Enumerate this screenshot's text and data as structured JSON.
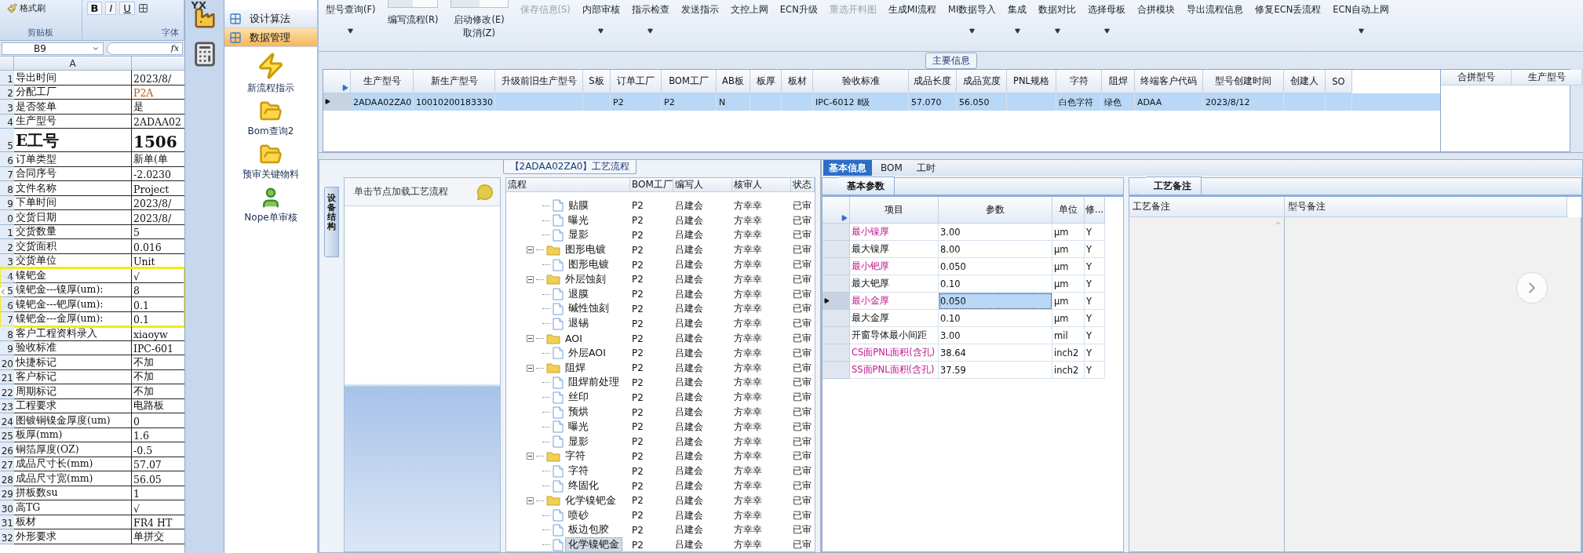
{
  "excel": {
    "ribbon": {
      "clipboard_button": "格式刷",
      "font_buttons": [
        "B",
        "I",
        "U"
      ],
      "groups": [
        "剪贴板",
        "字体"
      ]
    },
    "name_box": "B9",
    "formula_label": "fx",
    "column_headers": [
      "A"
    ],
    "rows": [
      {
        "number": "1",
        "label": "导出时间",
        "value": "2023/8/",
        "kind": "normal",
        "highlighted": false
      },
      {
        "number": "2",
        "label": "分配工厂",
        "value": "P2A",
        "kind": "accent",
        "highlighted": false
      },
      {
        "number": "3",
        "label": "是否签单",
        "value": "是",
        "kind": "normal",
        "highlighted": false
      },
      {
        "number": "4",
        "label": "生产型号",
        "value": "2ADAA02",
        "kind": "normal",
        "highlighted": false
      },
      {
        "number": "5",
        "label": "E工号",
        "value": "1506",
        "kind": "large",
        "highlighted": false
      },
      {
        "number": "6",
        "label": "订单类型",
        "value": "新单(单",
        "kind": "normal",
        "highlighted": false
      },
      {
        "number": "7",
        "label": "合同序号",
        "value": "-2.0230",
        "kind": "normal",
        "highlighted": false
      },
      {
        "number": "8",
        "label": "文件名称",
        "value": "Project",
        "kind": "normal",
        "highlighted": false
      },
      {
        "number": "9",
        "label": "下单时间",
        "value": "2023/8/",
        "kind": "normal",
        "highlighted": false
      },
      {
        "number": "0",
        "label": "交货日期",
        "value": "2023/8/",
        "kind": "normal",
        "highlighted": false
      },
      {
        "number": "1",
        "label": "交货数量",
        "value": "5",
        "kind": "normal",
        "highlighted": false
      },
      {
        "number": "2",
        "label": "交货面积",
        "value": "0.016",
        "kind": "normal",
        "highlighted": false
      },
      {
        "number": "3",
        "label": "交货单位",
        "value": "Unit",
        "kind": "normal",
        "highlighted": false
      },
      {
        "number": "4",
        "label": "镍钯金",
        "value": "√",
        "kind": "normal",
        "highlighted": true
      },
      {
        "number": "5",
        "label": "镍钯金---镍厚(um):",
        "value": "8",
        "kind": "normal",
        "highlighted": true
      },
      {
        "number": "6",
        "label": "镍钯金---钯厚(um):",
        "value": "0.1",
        "kind": "normal",
        "highlighted": true
      },
      {
        "number": "7",
        "label": "镍钯金---金厚(um):",
        "value": "0.1",
        "kind": "normal",
        "highlighted": true
      },
      {
        "number": "8",
        "label": "客户工程资料录入",
        "value": "xiaoyw",
        "kind": "normal",
        "highlighted": false
      },
      {
        "number": "9",
        "label": "验收标准",
        "value": "IPC-601",
        "kind": "normal",
        "highlighted": false
      },
      {
        "number": "20",
        "label": "快捷标记",
        "value": "不加",
        "kind": "normal",
        "highlighted": false
      },
      {
        "number": "21",
        "label": "客户标记",
        "value": "不加",
        "kind": "normal",
        "highlighted": false
      },
      {
        "number": "22",
        "label": "周期标记",
        "value": "不加",
        "kind": "normal",
        "highlighted": false
      },
      {
        "number": "23",
        "label": "工程要求",
        "value": "电路板",
        "kind": "normal",
        "highlighted": false
      },
      {
        "number": "24",
        "label": "图镀铜镍金厚度(um)",
        "value": "0",
        "kind": "normal",
        "highlighted": false
      },
      {
        "number": "25",
        "label": "板厚(mm)",
        "value": "1.6",
        "kind": "normal",
        "highlighted": false
      },
      {
        "number": "26",
        "label": "铜箔厚度(OZ)",
        "value": "-0.5",
        "kind": "normal",
        "highlighted": false
      },
      {
        "number": "27",
        "label": "成品尺寸长(mm)",
        "value": "57.07",
        "kind": "normal",
        "highlighted": false
      },
      {
        "number": "28",
        "label": "成品尺寸宽(mm)",
        "value": "56.05",
        "kind": "normal",
        "highlighted": false
      },
      {
        "number": "29",
        "label": "拼板数su",
        "value": "1",
        "kind": "normal",
        "highlighted": false
      },
      {
        "number": "30",
        "label": "高TG",
        "value": "√",
        "kind": "normal",
        "highlighted": false
      },
      {
        "number": "31",
        "label": "板材",
        "value": "FR4 HT",
        "kind": "normal",
        "highlighted": false
      },
      {
        "number": "32",
        "label": "外形要求",
        "value": "单拼交",
        "kind": "normal",
        "highlighted": false
      }
    ]
  },
  "app_strip": {
    "logo_text": "YX"
  },
  "nav": {
    "sections": [
      {
        "label": "设计算法",
        "selected": false
      },
      {
        "label": "数据管理",
        "selected": true
      }
    ],
    "tools": [
      {
        "label": "新流程指示",
        "kind": "bolt"
      },
      {
        "label": "Bom查询2",
        "kind": "folder"
      },
      {
        "label": "预审关键物料",
        "kind": "folder"
      },
      {
        "label": "Nope单审核",
        "kind": "person"
      }
    ]
  },
  "toolbar": [
    {
      "label": "型号查询(F)",
      "kind": "plain",
      "dropdown": true,
      "disabled": false
    },
    {
      "label": "编写流程(R)",
      "kind": "toggle",
      "dropdown": false,
      "disabled": false
    },
    {
      "label": "启动修改(E)",
      "sublabel": "取消(Z)",
      "kind": "toggle",
      "dropdown": false,
      "disabled": false
    },
    {
      "label": "保存信息(S)",
      "kind": "plain",
      "dropdown": false,
      "disabled": true
    },
    {
      "label": "内部审核",
      "kind": "plain",
      "dropdown": true,
      "disabled": false
    },
    {
      "label": "指示检查",
      "kind": "plain",
      "dropdown": true,
      "disabled": false
    },
    {
      "label": "发送指示",
      "kind": "plain",
      "dropdown": false,
      "disabled": false
    },
    {
      "label": "文控上网",
      "kind": "plain",
      "dropdown": false,
      "disabled": false
    },
    {
      "label": "ECN升级",
      "kind": "plain",
      "dropdown": false,
      "disabled": false
    },
    {
      "label": "重选开料图",
      "kind": "plain",
      "dropdown": false,
      "disabled": true
    },
    {
      "label": "生成MI流程",
      "kind": "plain",
      "dropdown": false,
      "disabled": false
    },
    {
      "label": "MI数据导入",
      "kind": "plain",
      "dropdown": true,
      "disabled": false
    },
    {
      "label": "集成",
      "kind": "plain",
      "dropdown": true,
      "disabled": false
    },
    {
      "label": "数据对比",
      "kind": "plain",
      "dropdown": true,
      "disabled": false
    },
    {
      "label": "选择母板",
      "kind": "plain",
      "dropdown": true,
      "disabled": false
    },
    {
      "label": "合拼模块",
      "kind": "plain",
      "dropdown": false,
      "disabled": false
    },
    {
      "label": "导出流程信息",
      "kind": "plain",
      "dropdown": false,
      "disabled": false
    },
    {
      "label": "修复ECN丢流程",
      "kind": "plain",
      "dropdown": false,
      "disabled": false
    },
    {
      "label": "ECN自动上网",
      "kind": "plain",
      "dropdown": true,
      "disabled": false
    }
  ],
  "main_info": {
    "title": "主要信息",
    "columns": [
      "生产型号",
      "新生产型号",
      "升级前旧生产型号",
      "S板",
      "订单工厂",
      "BOM工厂",
      "AB板",
      "板厚",
      "板材",
      "验收标准",
      "成品长度",
      "成品宽度",
      "PNL规格",
      "字符",
      "阻焊",
      "终端客户代码",
      "型号创建时间",
      "创建人",
      "SO"
    ],
    "rows": [
      {
        "selected": true,
        "cells": [
          "2ADAA02ZA0",
          "10010200183330",
          "",
          "",
          "P2",
          "P2",
          "N",
          "",
          "",
          "IPC-6012 Ⅱ级",
          "57.070",
          "56.050",
          "",
          "白色字符",
          "绿色",
          "ADAA",
          "2023/8/12",
          "",
          ""
        ]
      }
    ]
  },
  "merge_grid": {
    "columns": [
      "合拼型号",
      "生产型号"
    ]
  },
  "process_panel": {
    "title": "【2ADAA02ZA0】工艺流程",
    "side_tab": "设备结构",
    "hint": "单击节点加载工艺流程",
    "columns": [
      "流程",
      "BOM工厂",
      "编写人",
      "核审人",
      "状态"
    ],
    "nodes": [
      {
        "children": [
          {
            "name": "贴膜",
            "kind": "step",
            "bom": "P2",
            "writer": "吕建会",
            "reviewer": "方幸幸",
            "status": "已审",
            "selected": false
          },
          {
            "name": "曝光",
            "kind": "step",
            "bom": "P2",
            "writer": "吕建会",
            "reviewer": "方幸幸",
            "status": "已审",
            "selected": false
          },
          {
            "name": "显影",
            "kind": "step",
            "bom": "P2",
            "writer": "吕建会",
            "reviewer": "方幸幸",
            "status": "已审",
            "selected": false
          }
        ]
      },
      {
        "name": "图形电镀",
        "kind": "group",
        "expanded": true,
        "bom": "P2",
        "writer": "吕建会",
        "reviewer": "方幸幸",
        "status": "已审",
        "selected": false,
        "children": [
          {
            "name": "图形电镀",
            "kind": "step",
            "bom": "P2",
            "writer": "吕建会",
            "reviewer": "方幸幸",
            "status": "已审",
            "selected": false
          }
        ]
      },
      {
        "name": "外层蚀刻",
        "kind": "group",
        "expanded": true,
        "bom": "P2",
        "writer": "吕建会",
        "reviewer": "方幸幸",
        "status": "已审",
        "selected": false,
        "children": [
          {
            "name": "退膜",
            "kind": "step",
            "bom": "P2",
            "writer": "吕建会",
            "reviewer": "方幸幸",
            "status": "已审",
            "selected": false
          },
          {
            "name": "碱性蚀刻",
            "kind": "step",
            "bom": "P2",
            "writer": "吕建会",
            "reviewer": "方幸幸",
            "status": "已审",
            "selected": false
          },
          {
            "name": "退锡",
            "kind": "step",
            "bom": "P2",
            "writer": "吕建会",
            "reviewer": "方幸幸",
            "status": "已审",
            "selected": false
          }
        ]
      },
      {
        "name": "AOI",
        "kind": "group",
        "expanded": true,
        "bom": "P2",
        "writer": "吕建会",
        "reviewer": "方幸幸",
        "status": "已审",
        "selected": false,
        "children": [
          {
            "name": "外层AOI",
            "kind": "step",
            "bom": "P2",
            "writer": "吕建会",
            "reviewer": "方幸幸",
            "status": "已审",
            "selected": false
          }
        ]
      },
      {
        "name": "阻焊",
        "kind": "group",
        "expanded": true,
        "bom": "P2",
        "writer": "吕建会",
        "reviewer": "方幸幸",
        "status": "已审",
        "selected": false,
        "children": [
          {
            "name": "阻焊前处理",
            "kind": "step",
            "bom": "P2",
            "writer": "吕建会",
            "reviewer": "方幸幸",
            "status": "已审",
            "selected": false
          },
          {
            "name": "丝印",
            "kind": "step",
            "bom": "P2",
            "writer": "吕建会",
            "reviewer": "方幸幸",
            "status": "已审",
            "selected": false
          },
          {
            "name": "预烘",
            "kind": "step",
            "bom": "P2",
            "writer": "吕建会",
            "reviewer": "方幸幸",
            "status": "已审",
            "selected": false
          },
          {
            "name": "曝光",
            "kind": "step",
            "bom": "P2",
            "writer": "吕建会",
            "reviewer": "方幸幸",
            "status": "已审",
            "selected": false
          },
          {
            "name": "显影",
            "kind": "step",
            "bom": "P2",
            "writer": "吕建会",
            "reviewer": "方幸幸",
            "status": "已审",
            "selected": false
          }
        ]
      },
      {
        "name": "字符",
        "kind": "group",
        "expanded": true,
        "bom": "P2",
        "writer": "吕建会",
        "reviewer": "方幸幸",
        "status": "已审",
        "selected": false,
        "children": [
          {
            "name": "字符",
            "kind": "step",
            "bom": "P2",
            "writer": "吕建会",
            "reviewer": "方幸幸",
            "status": "已审",
            "selected": false
          },
          {
            "name": "终固化",
            "kind": "step",
            "bom": "P2",
            "writer": "吕建会",
            "reviewer": "方幸幸",
            "status": "已审",
            "selected": false
          }
        ]
      },
      {
        "name": "化学镍钯金",
        "kind": "group",
        "expanded": true,
        "bom": "P2",
        "writer": "吕建会",
        "reviewer": "方幸幸",
        "status": "已审",
        "selected": false,
        "children": [
          {
            "name": "喷砂",
            "kind": "step",
            "bom": "P2",
            "writer": "吕建会",
            "reviewer": "方幸幸",
            "status": "已审",
            "selected": false
          },
          {
            "name": "板边包胶",
            "kind": "step",
            "bom": "P2",
            "writer": "吕建会",
            "reviewer": "方幸幸",
            "status": "已审",
            "selected": false
          },
          {
            "name": "化学镍钯金",
            "kind": "step",
            "bom": "P2",
            "writer": "吕建会",
            "reviewer": "方幸幸",
            "status": "已审",
            "selected": true
          }
        ]
      }
    ]
  },
  "detail_tabs": [
    {
      "label": "基本信息",
      "selected": true
    },
    {
      "label": "BOM",
      "selected": false
    },
    {
      "label": "工时",
      "selected": false
    }
  ],
  "params": {
    "tab": "基本参数",
    "columns": [
      "项目",
      "参数",
      "单位",
      "修..."
    ],
    "rows": [
      {
        "item": "最小镍厚",
        "value": "3.00",
        "unit": "μm",
        "flag": "Y",
        "required": true,
        "selected": false
      },
      {
        "item": "最大镍厚",
        "value": "8.00",
        "unit": "μm",
        "flag": "Y",
        "required": false,
        "selected": false
      },
      {
        "item": "最小钯厚",
        "value": "0.050",
        "unit": "μm",
        "flag": "Y",
        "required": true,
        "selected": false
      },
      {
        "item": "最大钯厚",
        "value": "0.10",
        "unit": "μm",
        "flag": "Y",
        "required": false,
        "selected": false
      },
      {
        "item": "最小金厚",
        "value": "0.050",
        "unit": "μm",
        "flag": "Y",
        "required": true,
        "selected": true
      },
      {
        "item": "最大金厚",
        "value": "0.10",
        "unit": "μm",
        "flag": "Y",
        "required": false,
        "selected": false
      },
      {
        "item": "开窗导体最小间距",
        "value": "3.00",
        "unit": "mil",
        "flag": "Y",
        "required": false,
        "selected": false
      },
      {
        "item": "CS面PNL面积(含孔)",
        "value": "38.64",
        "unit": "inch2",
        "flag": "Y",
        "required": true,
        "selected": false
      },
      {
        "item": "SS面PNL面积(含孔)",
        "value": "37.59",
        "unit": "inch2",
        "flag": "Y",
        "required": true,
        "selected": false
      }
    ]
  },
  "notes": {
    "tab": "工艺备注",
    "columns": [
      "工艺备注",
      "型号备注"
    ]
  }
}
